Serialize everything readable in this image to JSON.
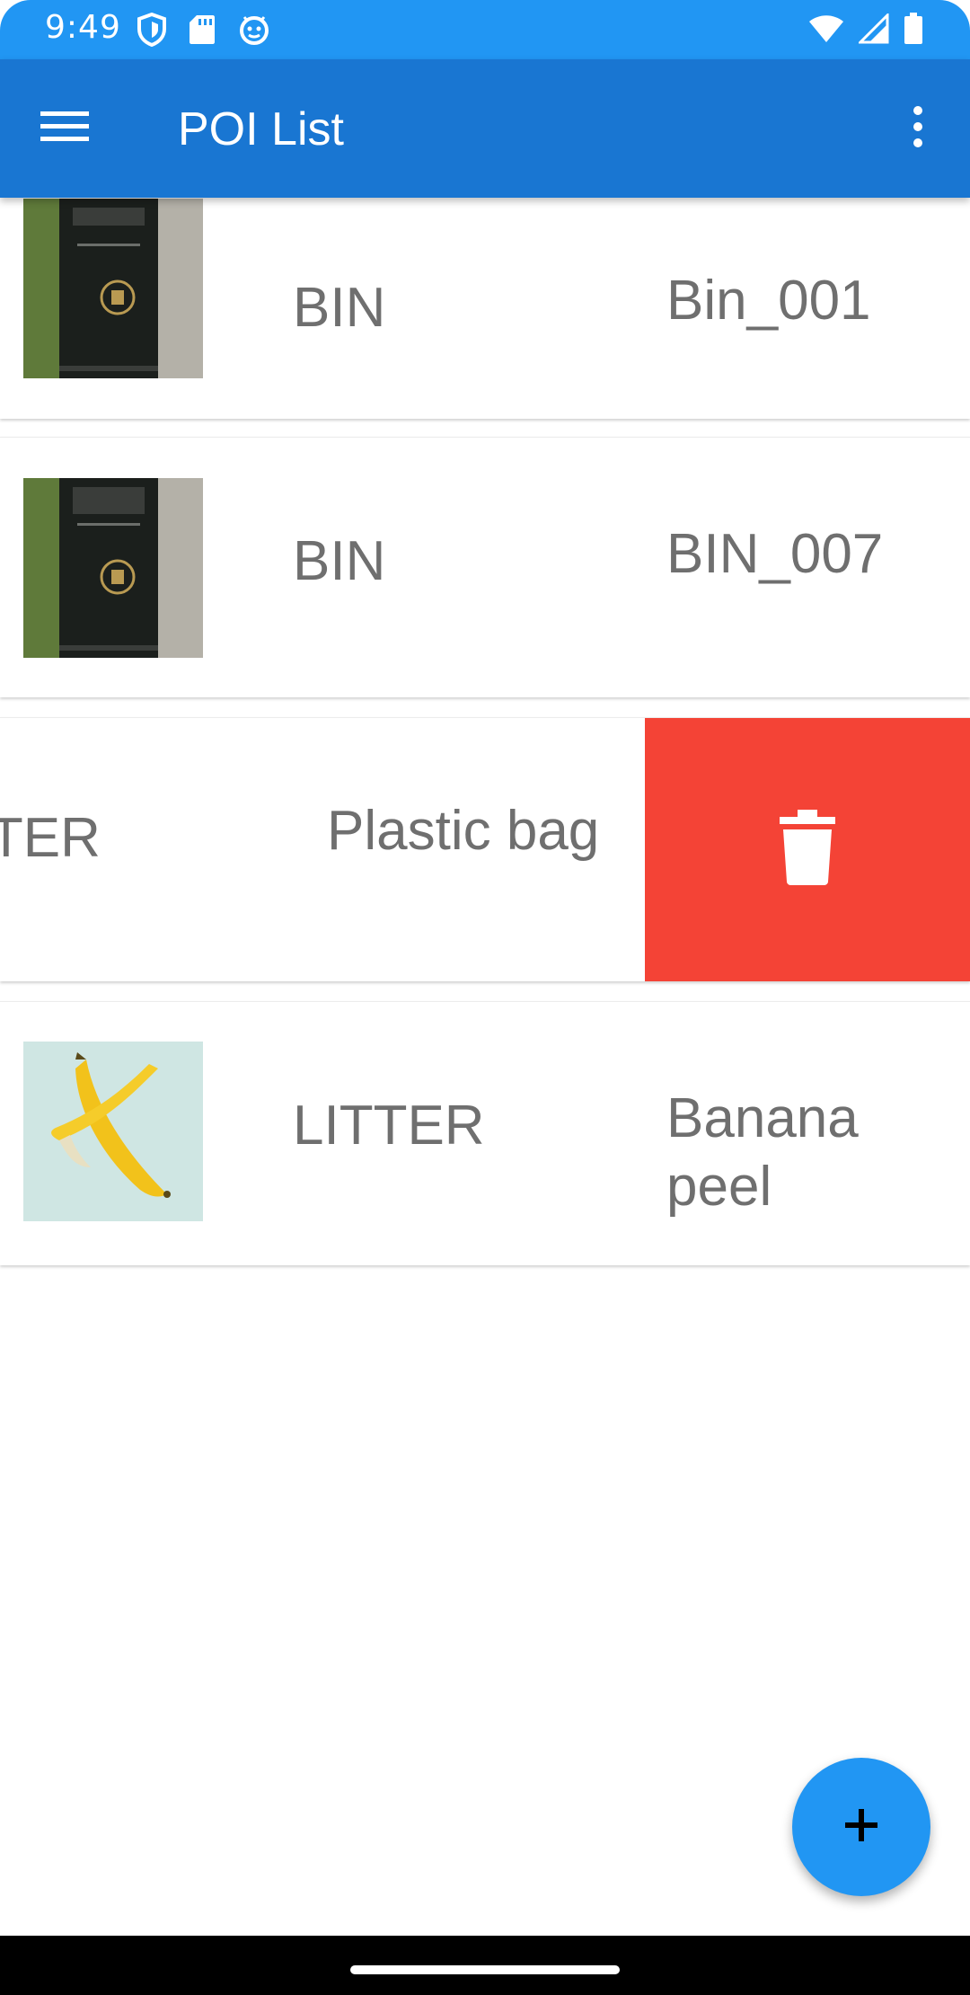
{
  "status_bar": {
    "time": "9:49",
    "left_icons": [
      "shield-icon",
      "sd-card-icon",
      "android-debug-icon"
    ],
    "right_icons": [
      "wifi-icon",
      "signal-icon",
      "battery-icon"
    ]
  },
  "app_bar": {
    "title": "POI List",
    "menu_icon": "hamburger-menu-icon",
    "overflow_icon": "more-vert-icon"
  },
  "poi_items": [
    {
      "type": "BIN",
      "name": "Bin_001",
      "image": "trash-bin-photo"
    },
    {
      "type": "BIN",
      "name": "BIN_007",
      "image": "trash-bin-photo"
    },
    {
      "type": "TTER",
      "name": "Plastic bag",
      "image": null,
      "swiped": true,
      "action_icon": "delete-icon"
    },
    {
      "type": "LITTER",
      "name": "Banana peel",
      "image": "banana-peel-photo"
    }
  ],
  "fab": {
    "icon": "add-icon"
  },
  "colors": {
    "status_bar": "#2196f3",
    "app_bar": "#1976d2",
    "delete_background": "#f44336",
    "fab": "#2196f3",
    "list_text": "#6f6f6f"
  }
}
